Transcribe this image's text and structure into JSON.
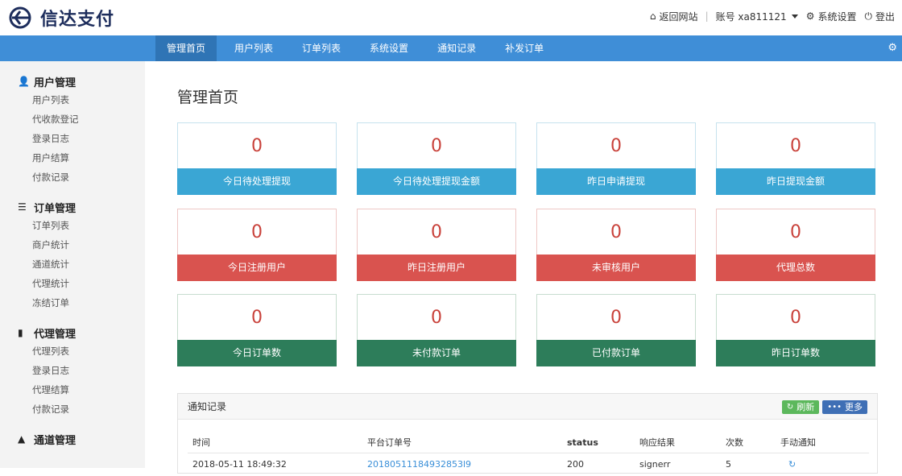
{
  "brand": {
    "name": "信达支付"
  },
  "top_links": {
    "back": "返回网站",
    "account": "账号 xa811121",
    "settings": "系统设置",
    "logout": "登出"
  },
  "nav": {
    "items": [
      "管理首页",
      "用户列表",
      "订单列表",
      "系统设置",
      "通知记录",
      "补发订单"
    ],
    "active_index": 0
  },
  "sidebar": {
    "groups": [
      {
        "title": "用户管理",
        "icon": "user-icon",
        "items": [
          "用户列表",
          "代收款登记",
          "登录日志",
          "用户结算",
          "付款记录"
        ]
      },
      {
        "title": "订单管理",
        "icon": "list-icon",
        "items": [
          "订单列表",
          "商户统计",
          "通道统计",
          "代理统计",
          "冻结订单"
        ]
      },
      {
        "title": "代理管理",
        "icon": "file-icon",
        "items": [
          "代理列表",
          "登录日志",
          "代理结算",
          "付款记录"
        ]
      },
      {
        "title": "通道管理",
        "icon": "channel-icon",
        "items": []
      }
    ]
  },
  "page_title": "管理首页",
  "stats": [
    {
      "value": "0",
      "label": "今日待处理提现",
      "color": "blue"
    },
    {
      "value": "0",
      "label": "今日待处理提现金额",
      "color": "blue"
    },
    {
      "value": "0",
      "label": "昨日申请提现",
      "color": "blue"
    },
    {
      "value": "0",
      "label": "昨日提现金额",
      "color": "blue"
    },
    {
      "value": "0",
      "label": "今日注册用户",
      "color": "red"
    },
    {
      "value": "0",
      "label": "昨日注册用户",
      "color": "red"
    },
    {
      "value": "0",
      "label": "未审核用户",
      "color": "red"
    },
    {
      "value": "0",
      "label": "代理总数",
      "color": "red"
    },
    {
      "value": "0",
      "label": "今日订单数",
      "color": "green"
    },
    {
      "value": "0",
      "label": "未付款订单",
      "color": "green"
    },
    {
      "value": "0",
      "label": "已付款订单",
      "color": "green"
    },
    {
      "value": "0",
      "label": "昨日订单数",
      "color": "green"
    }
  ],
  "colors": {
    "blue": "#3aa6d4",
    "red": "#d9534f",
    "green": "#2d7d5a",
    "nav": "#3f8ed7"
  },
  "notice": {
    "title": "通知记录",
    "refresh_label": "刷新",
    "more_label": "更多",
    "columns": [
      "时间",
      "平台订单号",
      "status",
      "响应结果",
      "次数",
      "手动通知"
    ],
    "rows": [
      {
        "time": "2018-05-11 18:49:32",
        "order_no": "20180511184932853l9",
        "status": "200",
        "result": "signerr",
        "count": "5"
      }
    ]
  }
}
